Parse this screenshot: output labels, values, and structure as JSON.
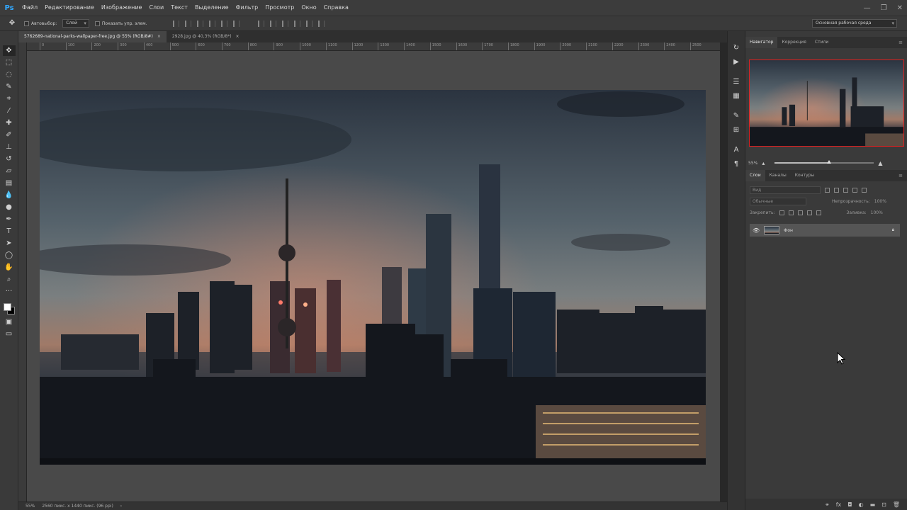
{
  "app": {
    "logo": "Ps"
  },
  "menu": [
    "Файл",
    "Редактирование",
    "Изображение",
    "Слои",
    "Текст",
    "Выделение",
    "Фильтр",
    "Просмотр",
    "Окно",
    "Справка"
  ],
  "options_bar": {
    "auto_select_label": "Автовыбор:",
    "auto_select_value": "Слой",
    "show_transform_label": "Показать упр. элем.",
    "workspace": "Основная рабочая среда"
  },
  "documents": [
    {
      "name": "5762689-national-parks-wallpaper-free.jpg @ 55% (RGB/8#)",
      "close": "×",
      "active": true
    },
    {
      "name": "2928.jpg @ 40,3% (RGB/8*)",
      "close": "×",
      "active": false
    }
  ],
  "ruler_ticks": [
    "0",
    "100",
    "200",
    "300",
    "400",
    "500",
    "600",
    "700",
    "800",
    "900",
    "1000",
    "1100",
    "1200",
    "1300",
    "1400",
    "1500",
    "1600",
    "1700",
    "1800",
    "1900",
    "2000",
    "2100",
    "2200",
    "2300",
    "2400",
    "2500"
  ],
  "status": {
    "zoom": "55%",
    "doc_info": "2560 пикс. x 1440 пикс. (96 ppi)",
    "arrow": "›"
  },
  "navigator": {
    "tabs": [
      "Навигатор",
      "Коррекция",
      "Стили"
    ],
    "zoom": "55%",
    "zoom_level": 0.55
  },
  "layers": {
    "tabs": [
      "Слои",
      "Каналы",
      "Контуры"
    ],
    "filter_placeholder": "Вид",
    "blend_mode": "Обычные",
    "opacity_label": "Непрозрачность:",
    "opacity_value": "100%",
    "lock_label": "Закрепить:",
    "fill_label": "Заливка:",
    "fill_value": "100%",
    "items": [
      {
        "name": "Фон",
        "visible": true,
        "locked": true
      }
    ]
  },
  "colors": {
    "accent": "#31a8ff",
    "navigator_frame": "#e02020",
    "panel_bg": "#3a3a3a",
    "canvas_bg": "#494949"
  },
  "toolbar_icons": [
    "move-icon",
    "marquee-icon",
    "lasso-icon",
    "quick-select-icon",
    "crop-icon",
    "eyedropper-icon",
    "healing-brush-icon",
    "brush-icon",
    "clone-stamp-icon",
    "history-brush-icon",
    "eraser-icon",
    "gradient-icon",
    "blur-icon",
    "dodge-icon",
    "pen-icon",
    "type-icon",
    "path-select-icon",
    "shape-icon",
    "hand-icon",
    "zoom-icon",
    "more-tools-icon"
  ]
}
